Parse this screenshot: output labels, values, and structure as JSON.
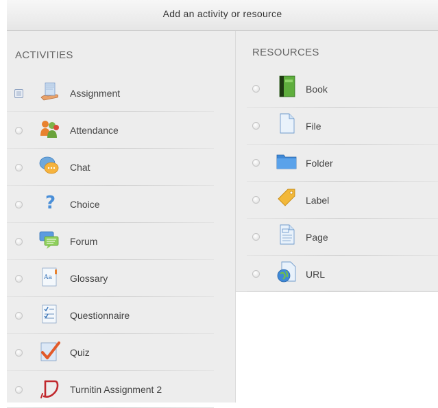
{
  "header": {
    "title": "Add an activity or resource"
  },
  "activities": {
    "heading": "ACTIVITIES",
    "items": [
      {
        "label": "Assignment",
        "icon": "assignment-icon",
        "selected": true
      },
      {
        "label": "Attendance",
        "icon": "attendance-icon",
        "selected": false
      },
      {
        "label": "Chat",
        "icon": "chat-icon",
        "selected": false
      },
      {
        "label": "Choice",
        "icon": "choice-icon",
        "selected": false
      },
      {
        "label": "Forum",
        "icon": "forum-icon",
        "selected": false
      },
      {
        "label": "Glossary",
        "icon": "glossary-icon",
        "selected": false
      },
      {
        "label": "Questionnaire",
        "icon": "questionnaire-icon",
        "selected": false
      },
      {
        "label": "Quiz",
        "icon": "quiz-icon",
        "selected": false
      },
      {
        "label": "Turnitin Assignment 2",
        "icon": "turnitin-icon",
        "selected": false
      }
    ]
  },
  "resources": {
    "heading": "RESOURCES",
    "items": [
      {
        "label": "Book",
        "icon": "book-icon",
        "selected": false
      },
      {
        "label": "File",
        "icon": "file-icon",
        "selected": false
      },
      {
        "label": "Folder",
        "icon": "folder-icon",
        "selected": false
      },
      {
        "label": "Label",
        "icon": "label-icon",
        "selected": false
      },
      {
        "label": "Page",
        "icon": "page-icon",
        "selected": false
      },
      {
        "label": "URL",
        "icon": "url-icon",
        "selected": false
      }
    ]
  },
  "colors": {
    "panel_bg": "#ededed",
    "header_bg": "#eeeeee",
    "text": "#444444",
    "selected_radio": "#c4cfe0"
  }
}
